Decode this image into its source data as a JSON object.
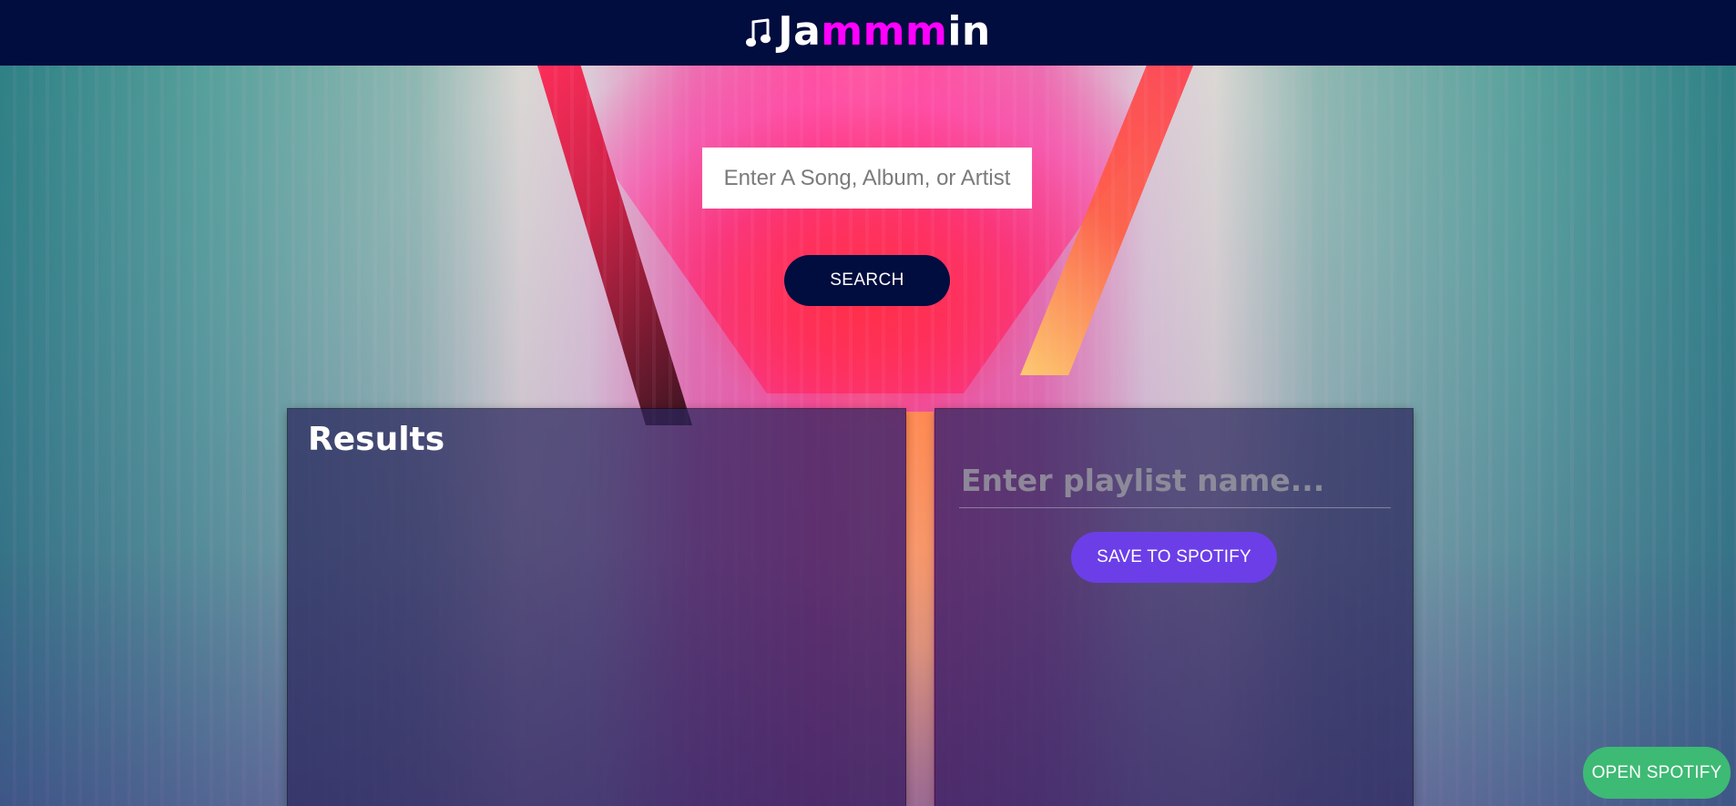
{
  "header": {
    "logo": {
      "icon": "music-note-icon",
      "prefix": "Ja",
      "accent": "mmm",
      "suffix": "in",
      "accent_color": "#ff00ff",
      "text_color": "#ffffff"
    },
    "background_color": "#010c3f"
  },
  "search": {
    "placeholder": "Enter A Song, Album, or Artist",
    "value": "",
    "button_label": "SEARCH"
  },
  "results": {
    "title": "Results",
    "items": []
  },
  "playlist": {
    "name_placeholder": "Enter playlist name...",
    "name_value": "",
    "save_label": "SAVE TO SPOTIFY",
    "tracks": []
  },
  "spotify": {
    "open_label": "OPEN SPOTIFY"
  },
  "colors": {
    "primary_dark": "#010c3f",
    "accent_purple": "#6c3ee8",
    "accent_green": "#3dba74"
  }
}
